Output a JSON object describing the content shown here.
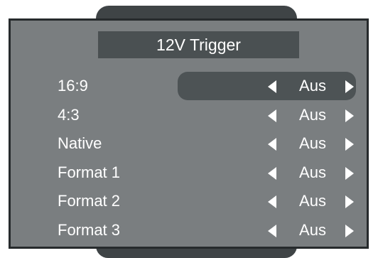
{
  "menu": {
    "title": "12V Trigger",
    "rows": [
      {
        "label": "16:9",
        "value": "Aus",
        "selected": true
      },
      {
        "label": "4:3",
        "value": "Aus",
        "selected": false
      },
      {
        "label": "Native",
        "value": "Aus",
        "selected": false
      },
      {
        "label": "Format 1",
        "value": "Aus",
        "selected": false
      },
      {
        "label": "Format 2",
        "value": "Aus",
        "selected": false
      },
      {
        "label": "Format 3",
        "value": "Aus",
        "selected": false
      }
    ]
  },
  "icons": {
    "left": "caret-left-icon",
    "right": "caret-right-icon"
  },
  "colors": {
    "panel": "#7a7e80",
    "title_bar": "#4a5052",
    "selection": "#4d5355",
    "border": "#262a2c",
    "text": "#ffffff"
  }
}
